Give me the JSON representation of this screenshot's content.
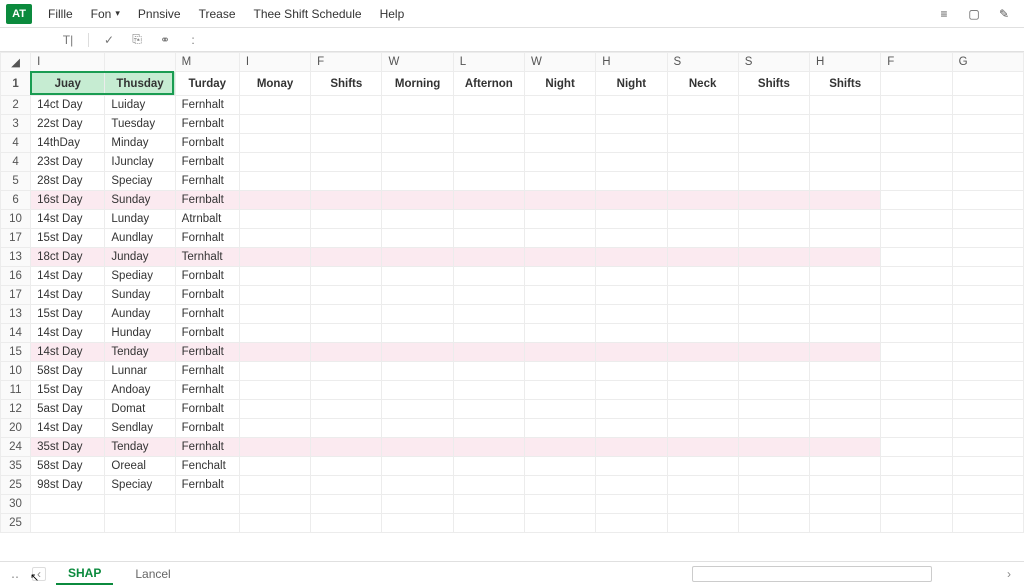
{
  "app": {
    "badge": "AT"
  },
  "menu": {
    "items": [
      "Fillle",
      "Fon",
      "Pnnsive",
      "Trease",
      "Thee Shift Schedule",
      "Help"
    ],
    "dropdown_indices": [
      1
    ]
  },
  "columns": {
    "letters": [
      "I",
      "",
      "M",
      "I",
      "F",
      "W",
      "L",
      "W",
      "H",
      "S",
      "S",
      "H",
      "F",
      "G"
    ],
    "headers": [
      "Juay",
      "Thusday",
      "Turday",
      "Monay",
      "Shifts",
      "Morning",
      "Afternon",
      "Night",
      "Night",
      "Neck",
      "Shifts",
      "Shifts",
      "",
      ""
    ]
  },
  "rows": [
    {
      "n": "2",
      "a": "14ct Day",
      "b": "Luiday",
      "c": "Fernhalt",
      "hl": false
    },
    {
      "n": "3",
      "a": "22st Day",
      "b": "Tuesday",
      "c": "Fernbalt",
      "hl": false
    },
    {
      "n": "4",
      "a": "14thDay",
      "b": "Minday",
      "c": "Fornbalt",
      "hl": false
    },
    {
      "n": "4",
      "a": "23st Day",
      "b": "IJunclay",
      "c": "Fernbalt",
      "hl": false
    },
    {
      "n": "5",
      "a": "28st Day",
      "b": "Speciay",
      "c": "Fernhalt",
      "hl": false
    },
    {
      "n": "6",
      "a": "16st Day",
      "b": "Sunday",
      "c": "Fernbalt",
      "hl": true
    },
    {
      "n": "10",
      "a": "14st Day",
      "b": "Lunday",
      "c": "Atrnbalt",
      "hl": false
    },
    {
      "n": "17",
      "a": "15st Day",
      "b": "Aundlay",
      "c": "Fornhalt",
      "hl": false
    },
    {
      "n": "13",
      "a": "18ct Day",
      "b": "Junday",
      "c": "Ternhalt",
      "hl": true
    },
    {
      "n": "16",
      "a": "14st Day",
      "b": "Spediay",
      "c": "Fornbalt",
      "hl": false
    },
    {
      "n": "17",
      "a": "14st Day",
      "b": "Sunday",
      "c": "Fornbalt",
      "hl": false
    },
    {
      "n": "13",
      "a": "15st Day",
      "b": "Aunday",
      "c": "Fornhalt",
      "hl": false
    },
    {
      "n": "14",
      "a": "14st Day",
      "b": "Hunday",
      "c": "Fornbalt",
      "hl": false
    },
    {
      "n": "15",
      "a": "14st Day",
      "b": "Tenday",
      "c": "Fernbalt",
      "hl": true
    },
    {
      "n": "10",
      "a": "58st Day",
      "b": "Lunnar",
      "c": "Fernhalt",
      "hl": false
    },
    {
      "n": "11",
      "a": "15st Day",
      "b": "Andoay",
      "c": "Fernhalt",
      "hl": false
    },
    {
      "n": "12",
      "a": "5ast Day",
      "b": "Domat",
      "c": "Fornbalt",
      "hl": false
    },
    {
      "n": "20",
      "a": "14st Day",
      "b": "Sendlay",
      "c": "Fornbalt",
      "hl": false
    },
    {
      "n": "24",
      "a": "35st Day",
      "b": "Tenday",
      "c": "Fernhalt",
      "hl": true
    },
    {
      "n": "35",
      "a": "58st Day",
      "b": "Oreeal",
      "c": "Fenchalt",
      "hl": false
    },
    {
      "n": "25",
      "a": "98st Day",
      "b": "Speciay",
      "c": "Fernbalt",
      "hl": false
    },
    {
      "n": "30",
      "a": "",
      "b": "",
      "c": "",
      "hl": false
    },
    {
      "n": "25",
      "a": "",
      "b": "",
      "c": "",
      "hl": false
    }
  ],
  "highlight_empty_last_two_cols": true,
  "tabs": {
    "active": "SHAP",
    "other": "Lancel",
    "nav_prev": "‹",
    "nav_first": "‥"
  },
  "icons": {
    "hamburger": "≡",
    "square": "▢",
    "pencil": "✎",
    "textbox": "T|",
    "check": "✓",
    "clip": "⎘",
    "link": "⚭",
    "colon": ":",
    "scroll_right": "›"
  }
}
